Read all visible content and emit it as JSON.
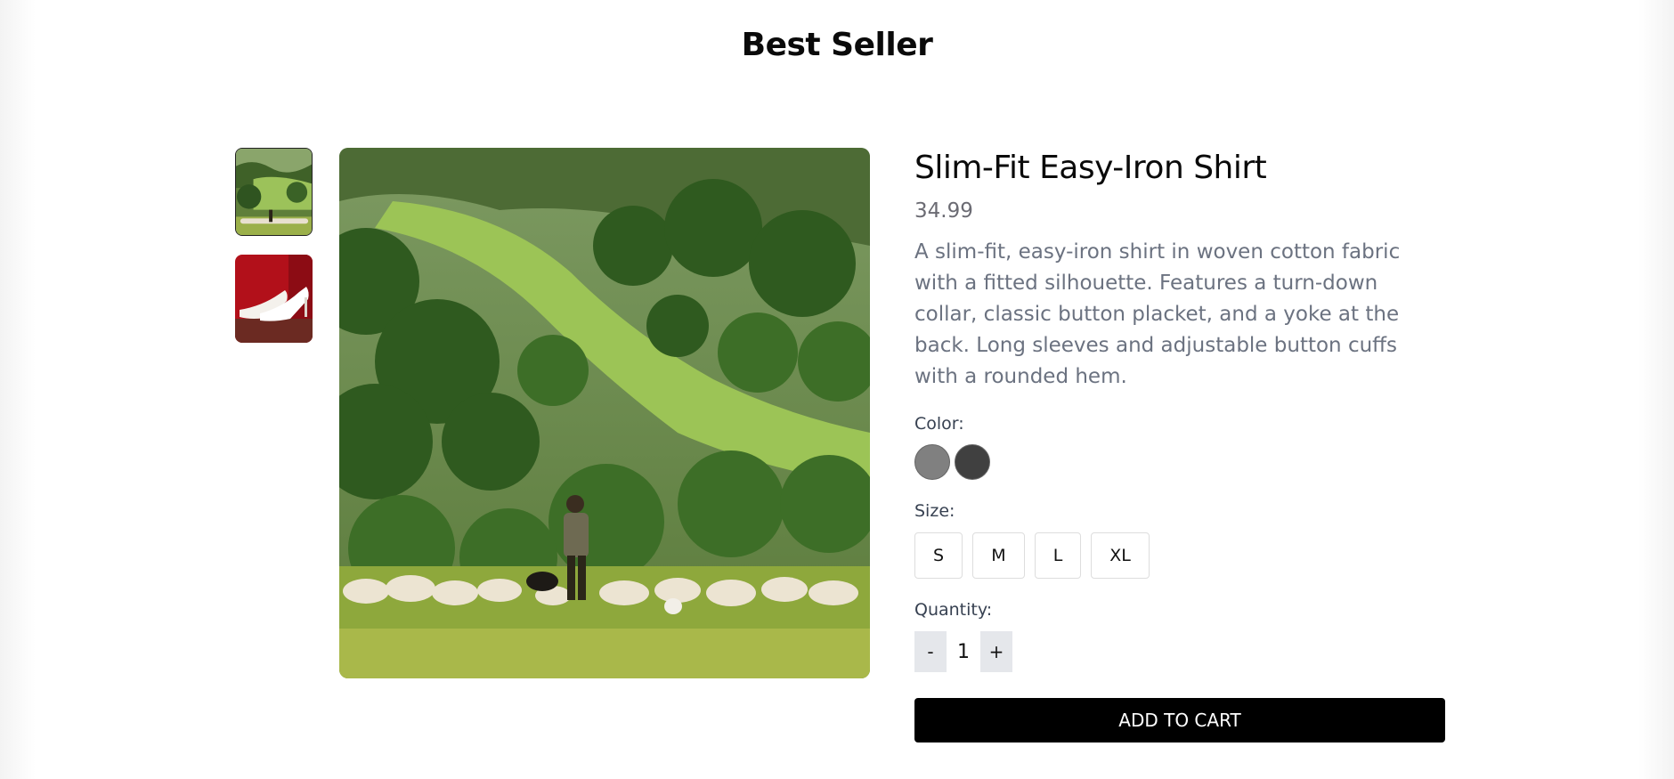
{
  "section": {
    "title": "Best Seller"
  },
  "gallery": {
    "thumbnails": [
      {
        "name": "landscape-sheep",
        "active": true
      },
      {
        "name": "white-heels",
        "active": false
      }
    ]
  },
  "product": {
    "name": "Slim-Fit Easy-Iron Shirt",
    "price": "34.99",
    "description": "A slim-fit, easy-iron shirt in woven cotton fabric with a fitted silhouette. Features a turn-down collar, classic button placket, and a yoke at the back. Long sleeves and adjustable button cuffs with a rounded hem."
  },
  "options": {
    "color_label": "Color:",
    "colors": [
      "#808080",
      "#404040"
    ],
    "size_label": "Size:",
    "sizes": [
      "S",
      "M",
      "L",
      "XL"
    ],
    "quantity_label": "Quantity:",
    "decrement": "-",
    "quantity": "1",
    "increment": "+"
  },
  "actions": {
    "add_to_cart": "ADD TO CART"
  }
}
